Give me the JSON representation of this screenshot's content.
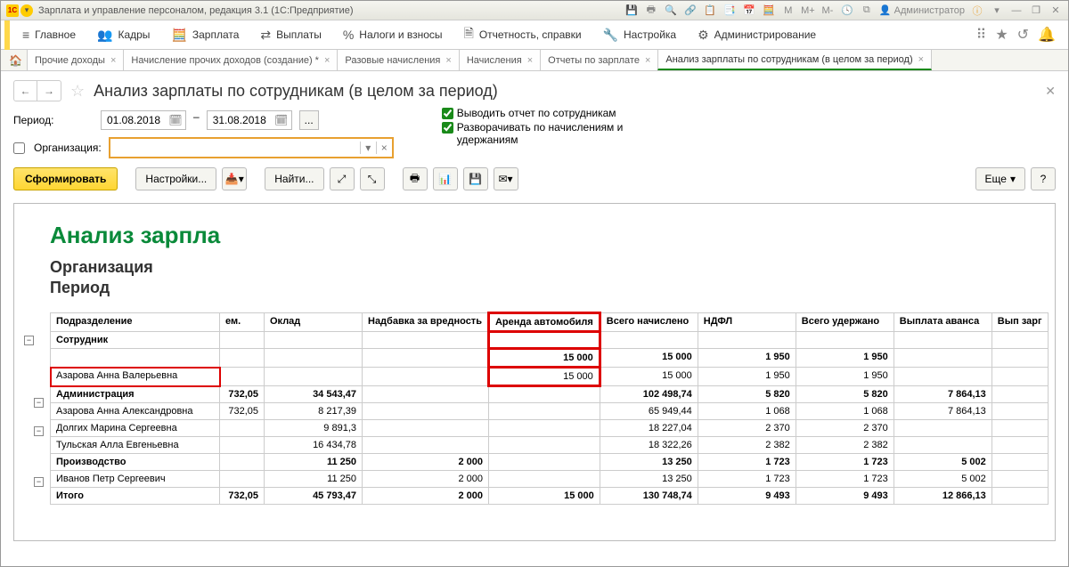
{
  "titlebar": {
    "title": "Зарплата и управление персоналом, редакция 3.1  (1С:Предприятие)",
    "user": "Администратор",
    "m_labels": [
      "M",
      "M+",
      "M-"
    ]
  },
  "mainmenu": {
    "items": [
      {
        "icon": "≡",
        "label": "Главное"
      },
      {
        "icon": "👥",
        "label": "Кадры"
      },
      {
        "icon": "🧮",
        "label": "Зарплата"
      },
      {
        "icon": "⇄",
        "label": "Выплаты"
      },
      {
        "icon": "%",
        "label": "Налоги и взносы"
      },
      {
        "icon": "🗎",
        "label": "Отчетность, справки"
      },
      {
        "icon": "🔧",
        "label": "Настройка"
      },
      {
        "icon": "⚙",
        "label": "Администрирование"
      }
    ]
  },
  "tabs": [
    {
      "label": "Прочие доходы",
      "active": false
    },
    {
      "label": "Начисление прочих доходов (создание) *",
      "active": false
    },
    {
      "label": "Разовые начисления",
      "active": false
    },
    {
      "label": "Начисления",
      "active": false
    },
    {
      "label": "Отчеты по зарплате",
      "active": false
    },
    {
      "label": "Анализ зарплаты по сотрудникам (в целом за период)",
      "active": true
    }
  ],
  "page": {
    "title": "Анализ зарплаты по сотрудникам (в целом за период)"
  },
  "filters": {
    "period_label": "Период:",
    "date_from": "01.08.2018",
    "dash": "–",
    "date_to": "31.08.2018",
    "org_label": "Организация:",
    "org_value": "",
    "check1": "Выводить отчет по сотрудникам",
    "check2": "Разворачивать по начислениям и удержаниям"
  },
  "toolbar": {
    "form": "Сформировать",
    "settings": "Настройки...",
    "find": "Найти...",
    "more": "Еще",
    "help": "?"
  },
  "report": {
    "title": "Анализ зарпла",
    "sub1": "Организация",
    "sub2": "Период",
    "head_dept": "Подразделение",
    "head_emp": "Сотрудник",
    "cols": [
      "ем.",
      "Оклад",
      "Надбавка за вредность",
      "Аренда автомобиля",
      "Всего начислено",
      "НДФЛ",
      "Всего удержано",
      "Выплата аванса",
      "Вып зарг"
    ],
    "rows": [
      {
        "bold": true,
        "redname": false,
        "name": "",
        "c": [
          "",
          "",
          "",
          "15 000",
          "15 000",
          "1 950",
          "1 950",
          "",
          ""
        ],
        "redcol": true
      },
      {
        "bold": false,
        "redname": true,
        "name": "Азарова Анна Валерьевна",
        "c": [
          "",
          "",
          "",
          "15 000",
          "15 000",
          "1 950",
          "1 950",
          "",
          ""
        ],
        "redcol": true
      },
      {
        "bold": true,
        "redname": false,
        "name": "Администрация",
        "c": [
          "732,05",
          "34 543,47",
          "",
          "",
          "102 498,74",
          "5 820",
          "5 820",
          "7 864,13",
          ""
        ]
      },
      {
        "bold": false,
        "redname": false,
        "name": "Азарова Анна Александровна",
        "c": [
          "732,05",
          "8 217,39",
          "",
          "",
          "65 949,44",
          "1 068",
          "1 068",
          "7 864,13",
          ""
        ]
      },
      {
        "bold": false,
        "redname": false,
        "name": "Долгих Марина Сергеевна",
        "c": [
          "",
          "9 891,3",
          "",
          "",
          "18 227,04",
          "2 370",
          "2 370",
          "",
          ""
        ]
      },
      {
        "bold": false,
        "redname": false,
        "name": "Тульская Алла Евгеньевна",
        "c": [
          "",
          "16 434,78",
          "",
          "",
          "18 322,26",
          "2 382",
          "2 382",
          "",
          ""
        ]
      },
      {
        "bold": true,
        "redname": false,
        "name": "Производство",
        "c": [
          "",
          "11 250",
          "2 000",
          "",
          "13 250",
          "1 723",
          "1 723",
          "5 002",
          ""
        ]
      },
      {
        "bold": false,
        "redname": false,
        "name": "Иванов Петр Сергеевич",
        "c": [
          "",
          "11 250",
          "2 000",
          "",
          "13 250",
          "1 723",
          "1 723",
          "5 002",
          ""
        ]
      },
      {
        "bold": true,
        "redname": false,
        "name": "Итого",
        "c": [
          "732,05",
          "45 793,47",
          "2 000",
          "15 000",
          "130 748,74",
          "9 493",
          "9 493",
          "12 866,13",
          ""
        ]
      }
    ]
  }
}
